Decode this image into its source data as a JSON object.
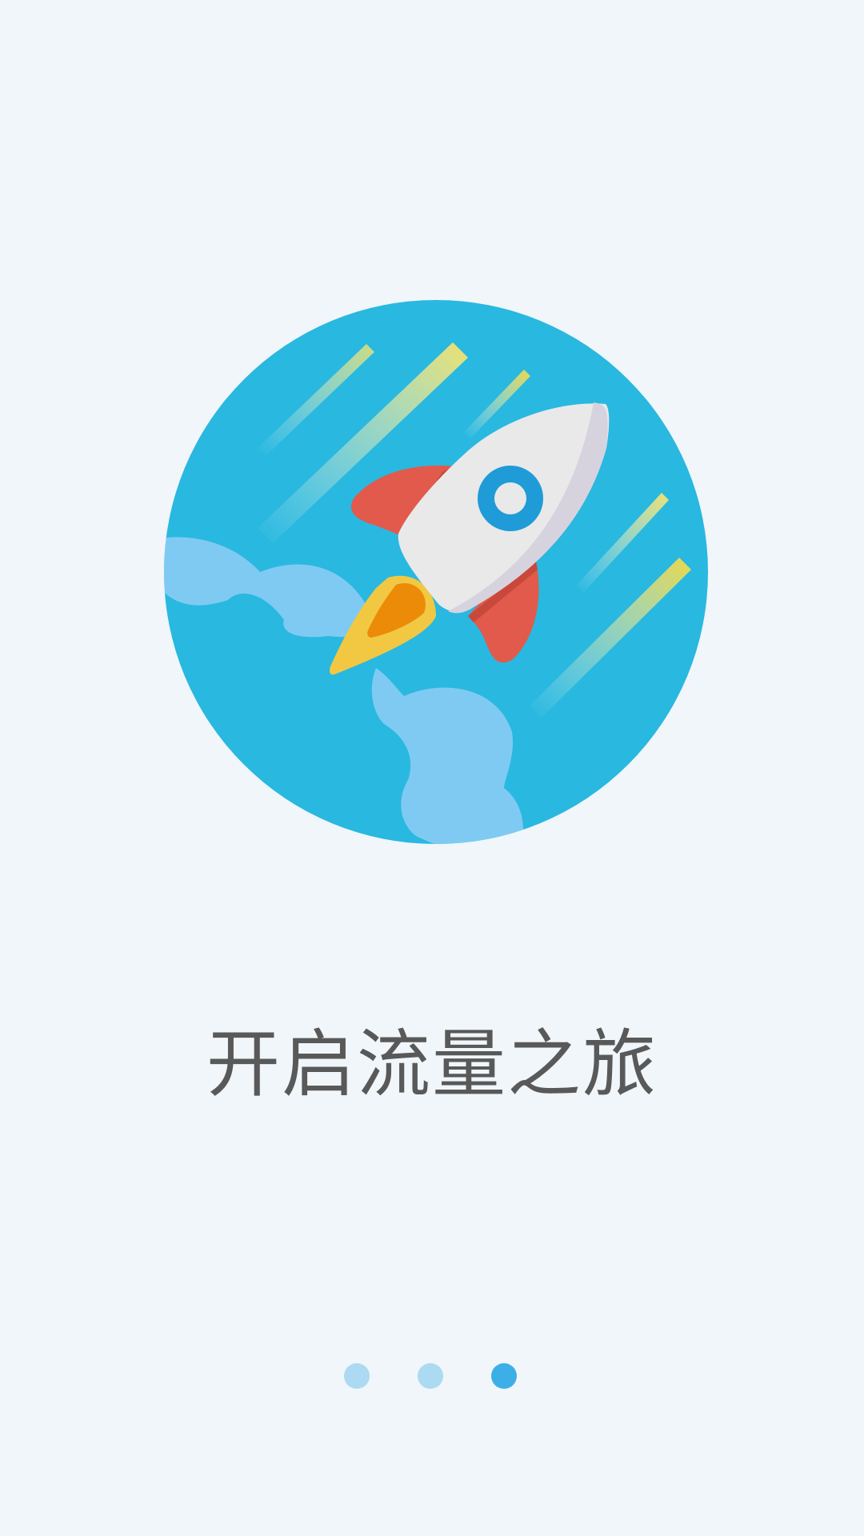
{
  "page": {
    "tagline": "开启流量之旅"
  },
  "illustration": {
    "icon": "rocket-icon",
    "description_colors": {
      "circle": "#29b8e0",
      "cloud": "#7fcaf2",
      "rocket_body": "#e9e9ea",
      "rocket_fin": "#e25a4b",
      "flame_outer": "#f2c843",
      "flame_inner": "#ec8b07",
      "window": "#1f9bd8"
    }
  },
  "pager": {
    "total": 3,
    "active_index": 2,
    "active_color": "#3eafe6",
    "inactive_color": "#abdaf2"
  }
}
